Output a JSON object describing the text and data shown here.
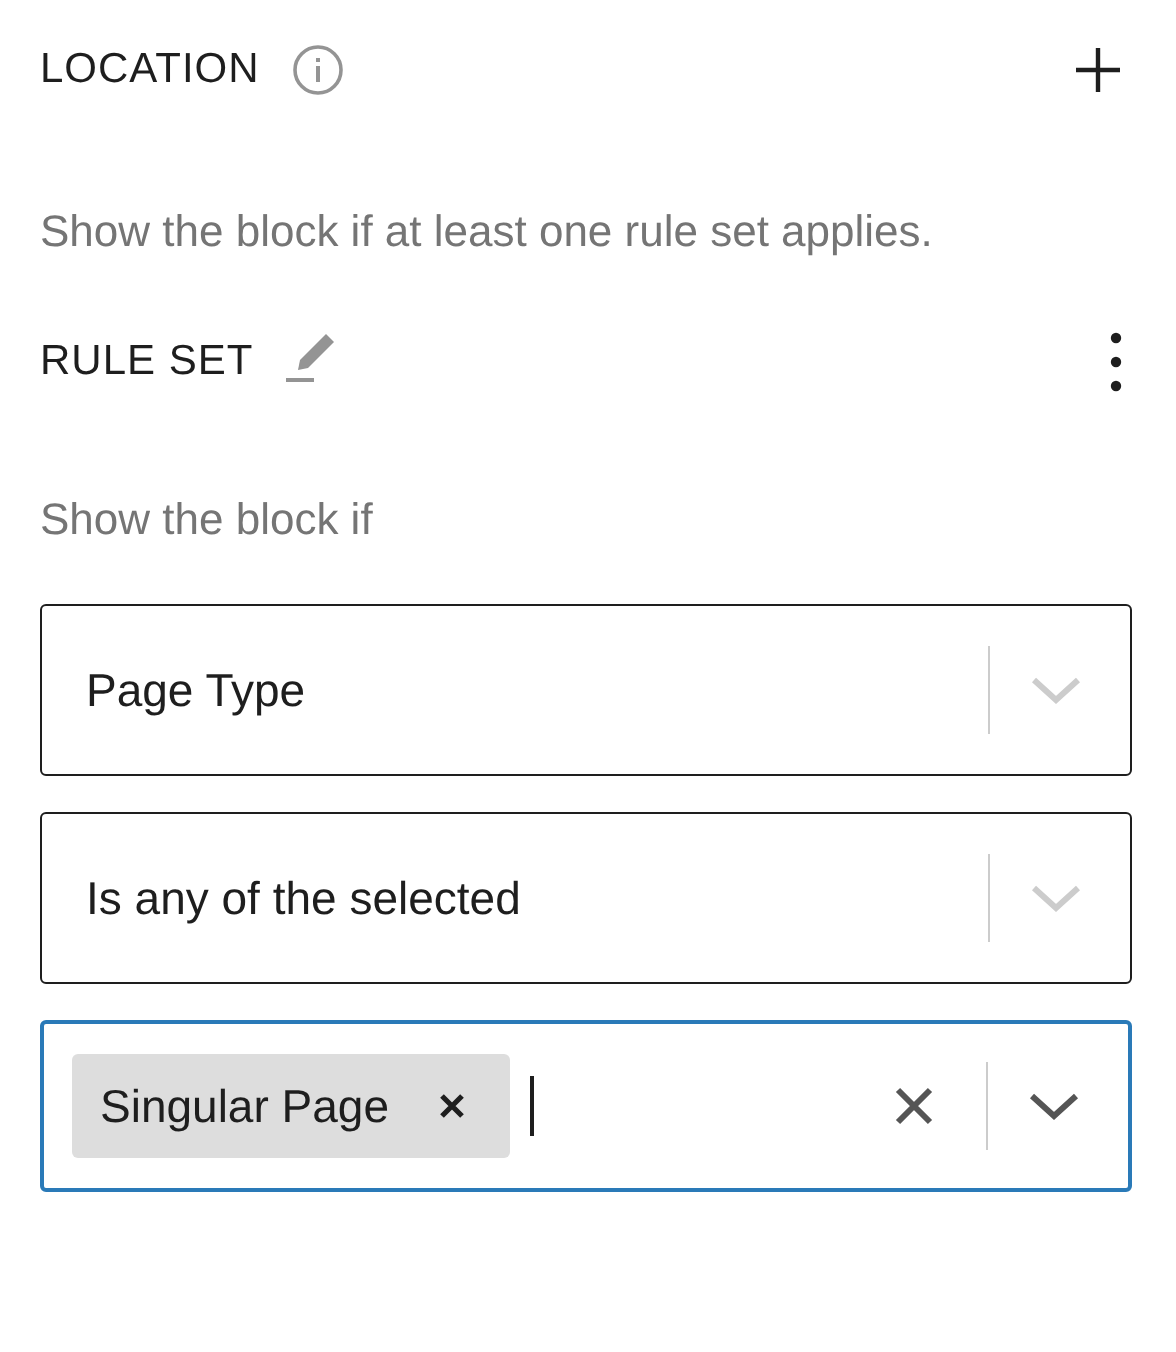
{
  "section": {
    "title": "LOCATION",
    "description": "Show the block if at least one rule set applies."
  },
  "rule_set": {
    "title": "RULE SET",
    "intro": "Show the block if"
  },
  "selects": [
    {
      "kind": "single",
      "value": "Page Type",
      "focused": false
    },
    {
      "kind": "single",
      "value": "Is any of the selected",
      "focused": false
    },
    {
      "kind": "multi",
      "tags": [
        "Singular Page"
      ],
      "focused": true
    }
  ]
}
